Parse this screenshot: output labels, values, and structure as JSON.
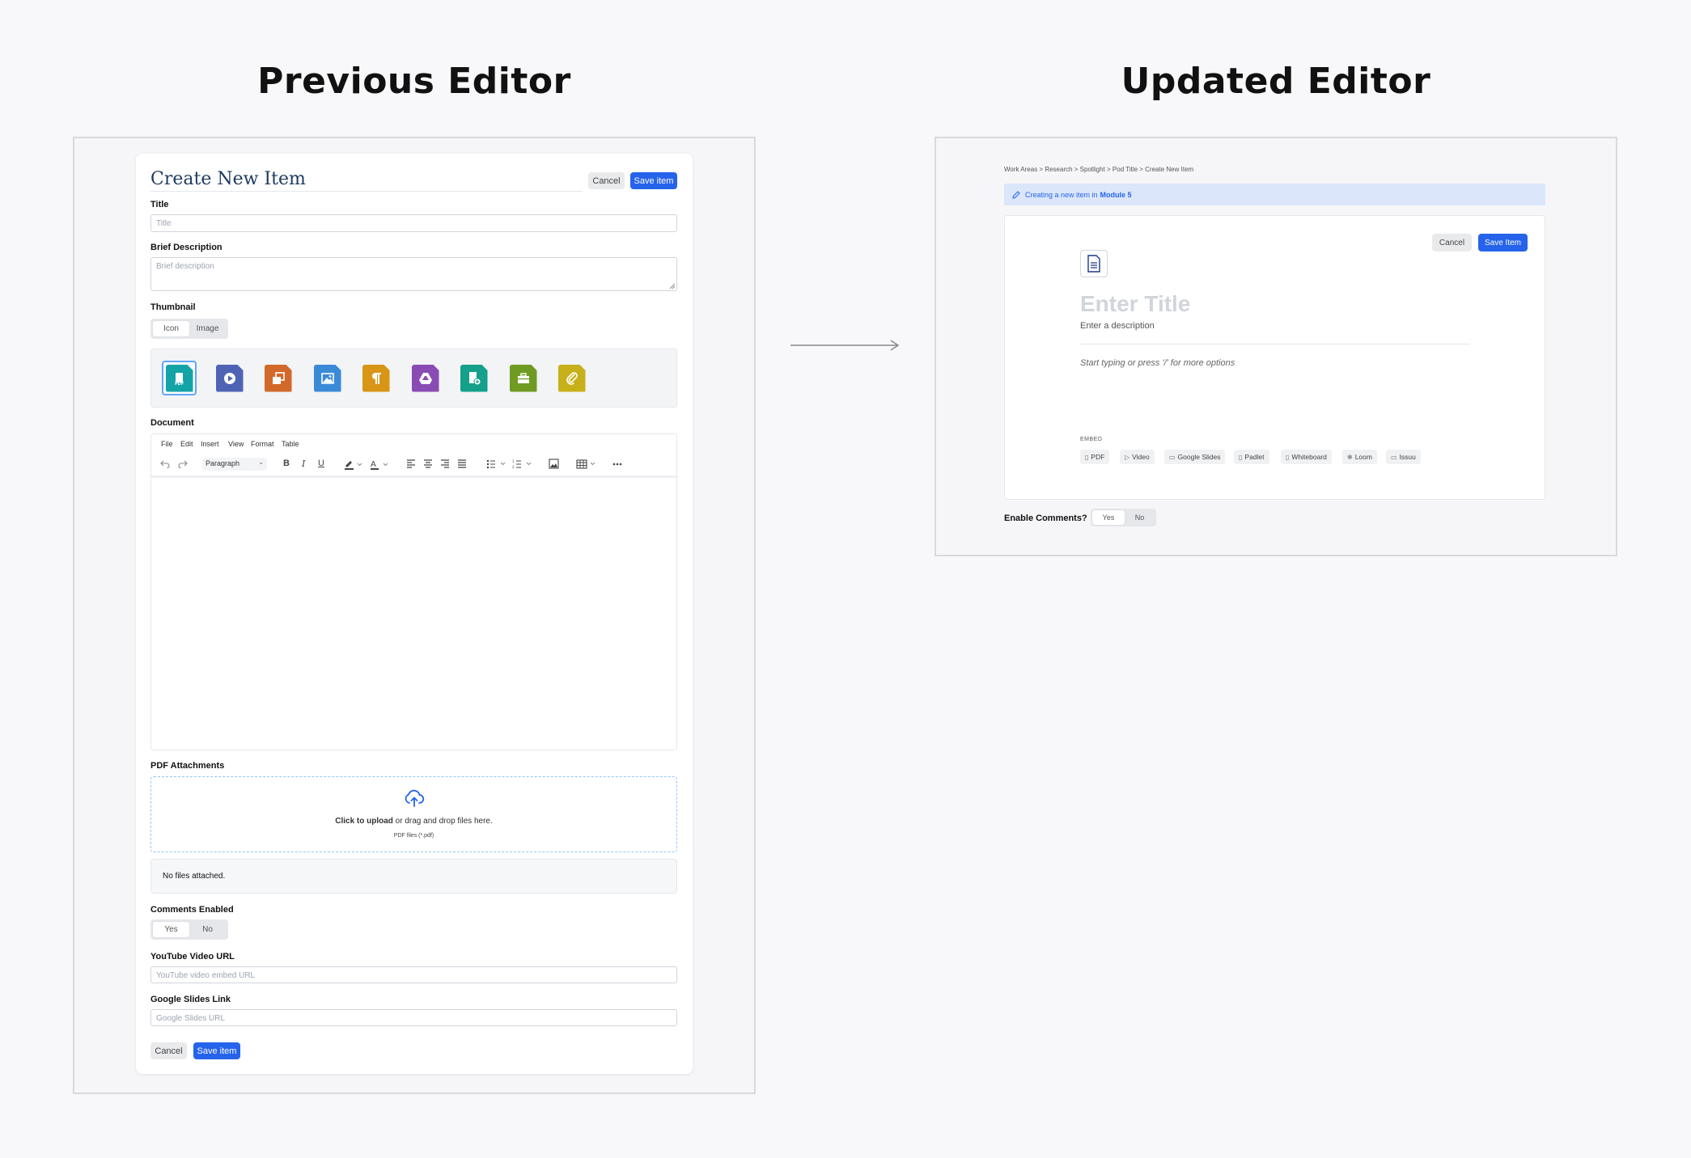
{
  "headings": {
    "left": "Previous Editor",
    "right": "Updated Editor"
  },
  "previous": {
    "title": "Create New Item",
    "cancel": "Cancel",
    "save": "Save item",
    "title_label": "Title",
    "title_placeholder": "Title",
    "brief_label": "Brief Description",
    "brief_placeholder": "Brief description",
    "thumbnail_label": "Thumbnail",
    "thumb_options": [
      "Icon",
      "Image"
    ],
    "thumb_selected": "Icon",
    "icons": [
      {
        "name": "pdf-icon",
        "color": "#14a3a7"
      },
      {
        "name": "video-icon",
        "color": "#4f63b5"
      },
      {
        "name": "slides-icon",
        "color": "#d2692b"
      },
      {
        "name": "image-icon",
        "color": "#3b8ad8"
      },
      {
        "name": "paragraph-icon",
        "color": "#d99516"
      },
      {
        "name": "drive-icon",
        "color": "#8a4bb5"
      },
      {
        "name": "add-file-icon",
        "color": "#14a08a"
      },
      {
        "name": "toolbox-icon",
        "color": "#6f9b22"
      },
      {
        "name": "attachment-icon",
        "color": "#c7b01a"
      }
    ],
    "document_label": "Document",
    "menu": [
      "File",
      "Edit",
      "Insert",
      "View",
      "Format",
      "Table"
    ],
    "paragraph": "Paragraph",
    "pdf_label": "PDF Attachments",
    "upload_bold": "Click to upload",
    "upload_rest": " or drag and drop files here.",
    "upload_hint": "PDF files (*.pdf)",
    "no_files": "No files attached.",
    "comments_label": "Comments Enabled",
    "comments_options": [
      "Yes",
      "No"
    ],
    "youtube_label": "YouTube Video URL",
    "youtube_placeholder": "YouTube video embed URL",
    "slides_label": "Google Slides Link",
    "slides_placeholder": "Google Slides URL",
    "bottom_cancel": "Cancel",
    "bottom_save": "Save item"
  },
  "updated": {
    "breadcrumb": "Work Areas > Research > Spotlight > Pod Title > Create New Item",
    "banner_prefix": "Creating a new item in",
    "banner_module": "Module 5",
    "cancel": "Cancel",
    "save": "Save Item",
    "title_placeholder": "Enter Title",
    "desc_placeholder": "Enter a description",
    "body_placeholder": "Start typing or press '/' for more options",
    "embed_label": "EMBED",
    "embeds": [
      "PDF",
      "Video",
      "Google Slides",
      "Padlet",
      "Whiteboard",
      "Loom",
      "Issuu"
    ],
    "comments_label": "Enable Comments?",
    "comments_options": [
      "Yes",
      "No"
    ]
  },
  "colors": {
    "accent": "#2563eb",
    "banner_bg": "#dbe6fb"
  }
}
